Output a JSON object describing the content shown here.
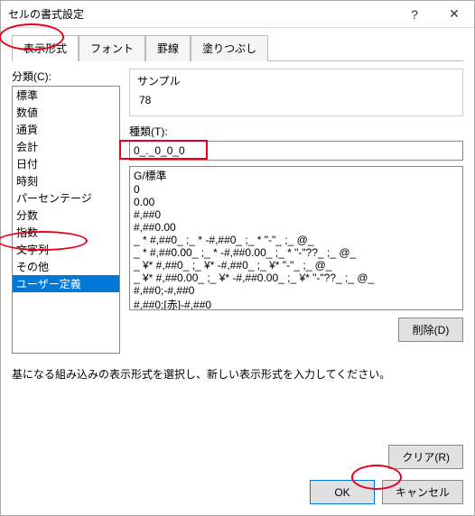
{
  "window": {
    "title": "セルの書式設定",
    "help_icon": "?",
    "close_icon": "✕"
  },
  "tabs": [
    {
      "label": "表示形式",
      "active": true
    },
    {
      "label": "フォント",
      "active": false
    },
    {
      "label": "罫線",
      "active": false
    },
    {
      "label": "塗りつぶし",
      "active": false
    }
  ],
  "category": {
    "label": "分類(C):",
    "items": [
      "標準",
      "数値",
      "通貨",
      "会計",
      "日付",
      "時刻",
      "パーセンテージ",
      "分数",
      "指数",
      "文字列",
      "その他",
      "ユーザー定義"
    ],
    "selected_index": 11
  },
  "sample": {
    "label": "サンプル",
    "value": "78"
  },
  "type": {
    "label": "種類(T):",
    "value": "0_._0_0_0"
  },
  "format_list": [
    "G/標準",
    "0",
    "0.00",
    "#,##0",
    "#,##0.00",
    "_ * #,##0_ ;_ * -#,##0_ ;_ * \"-\"_ ;_ @_",
    "_ * #,##0.00_ ;_ * -#,##0.00_ ;_ * \"-\"??_ ;_ @_",
    "_ ¥* #,##0_ ;_ ¥* -#,##0_ ;_ ¥* \"-\"_ ;_ @_",
    "_ ¥* #,##0.00_ ;_ ¥* -#,##0.00_ ;_ ¥* \"-\"??_ ;_ @_",
    "#,##0;-#,##0",
    "#,##0;[赤]-#,##0"
  ],
  "buttons": {
    "delete": "削除(D)",
    "clear": "クリア(R)",
    "ok": "OK",
    "cancel": "キャンセル"
  },
  "hint": "基になる組み込みの表示形式を選択し、新しい表示形式を入力してください。"
}
